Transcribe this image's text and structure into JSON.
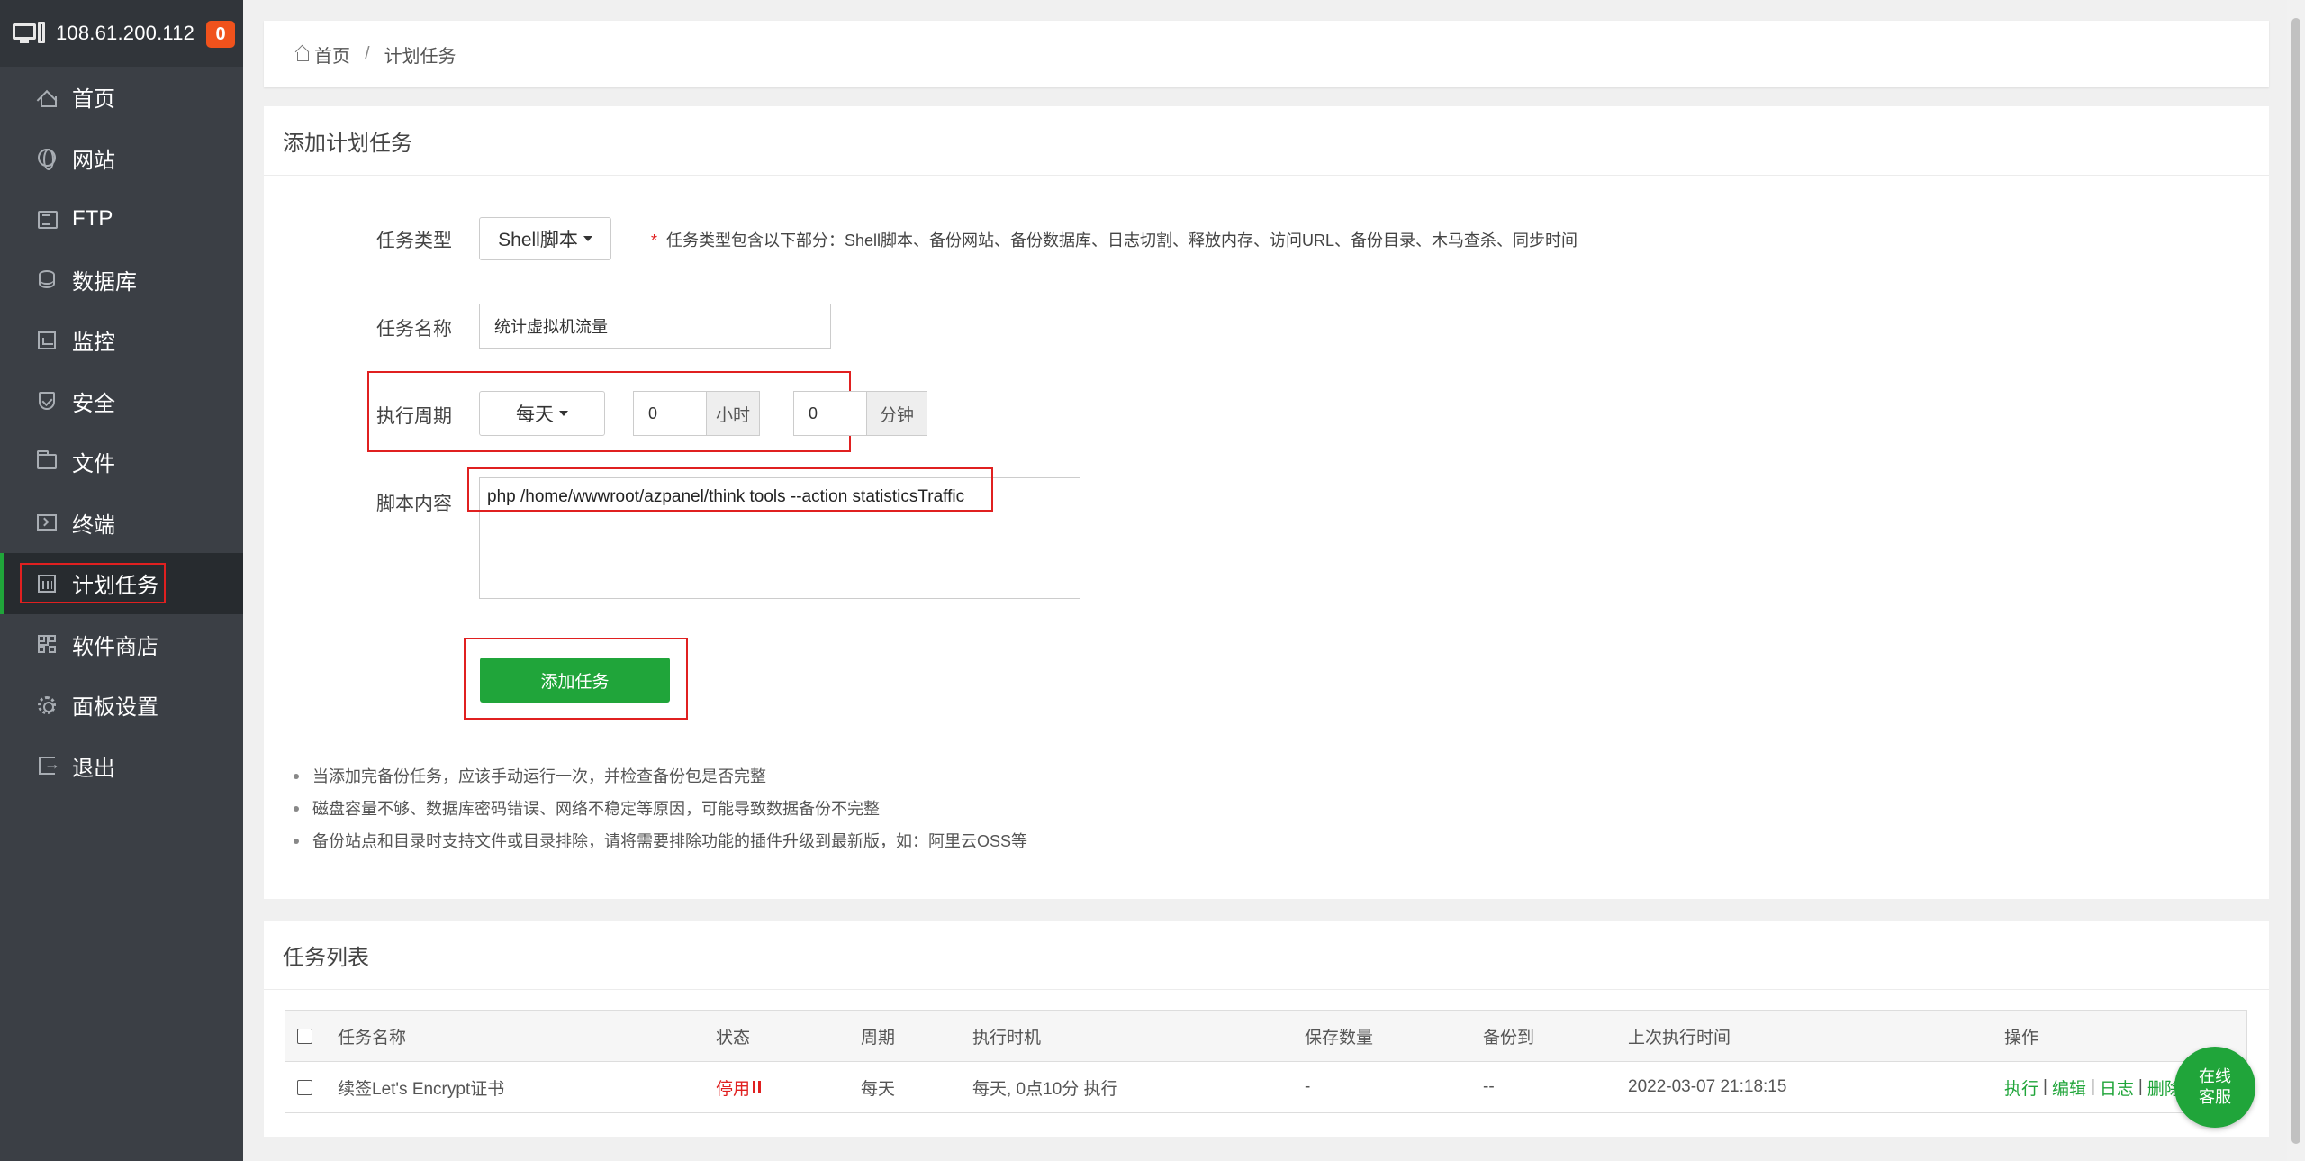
{
  "server": {
    "ip": "108.61.200.112",
    "badge": "0"
  },
  "sidebar": {
    "items": [
      {
        "label": "首页",
        "icon": "home-icon"
      },
      {
        "label": "网站",
        "icon": "globe-icon"
      },
      {
        "label": "FTP",
        "icon": "ftp-icon"
      },
      {
        "label": "数据库",
        "icon": "database-icon"
      },
      {
        "label": "监控",
        "icon": "monitor-icon"
      },
      {
        "label": "安全",
        "icon": "shield-icon"
      },
      {
        "label": "文件",
        "icon": "folder-icon"
      },
      {
        "label": "终端",
        "icon": "terminal-icon"
      },
      {
        "label": "计划任务",
        "icon": "calendar-icon",
        "active": true
      },
      {
        "label": "软件商店",
        "icon": "grid-icon"
      },
      {
        "label": "面板设置",
        "icon": "gear-icon"
      },
      {
        "label": "退出",
        "icon": "exit-icon"
      }
    ]
  },
  "breadcrumb": {
    "home": "首页",
    "separator": "/",
    "current": "计划任务"
  },
  "add_task": {
    "title": "添加计划任务",
    "type_label": "任务类型",
    "type_value": "Shell脚本",
    "type_hint_star": "*",
    "type_hint": "任务类型包含以下部分：Shell脚本、备份网站、备份数据库、日志切割、释放内存、访问URL、备份目录、木马查杀、同步时间",
    "name_label": "任务名称",
    "name_value": "统计虚拟机流量",
    "period_label": "执行周期",
    "period_value": "每天",
    "hour_value": "0",
    "hour_unit": "小时",
    "minute_value": "0",
    "minute_unit": "分钟",
    "script_label": "脚本内容",
    "script_value": "php /home/wwwroot/azpanel/think tools --action statisticsTraffic",
    "submit_label": "添加任务",
    "tips": [
      "当添加完备份任务，应该手动运行一次，并检查备份包是否完整",
      "磁盘容量不够、数据库密码错误、网络不稳定等原因，可能导致数据备份不完整",
      "备份站点和目录时支持文件或目录排除，请将需要排除功能的插件升级到最新版，如：阿里云OSS等"
    ]
  },
  "task_list": {
    "title": "任务列表",
    "columns": [
      "任务名称",
      "状态",
      "周期",
      "执行时机",
      "保存数量",
      "备份到",
      "上次执行时间",
      "操作"
    ],
    "rows": [
      {
        "name": "续签Let's Encrypt证书",
        "status": "停用",
        "period": "每天",
        "timing": "每天, 0点10分 执行",
        "keep": "-",
        "backup_to": "--",
        "last_run": "2022-03-07 21:18:15",
        "ops": [
          "执行",
          "编辑",
          "日志",
          "删除"
        ]
      }
    ]
  },
  "service": {
    "line1": "在线",
    "line2": "客服"
  },
  "colors": {
    "accent": "#20a53a",
    "sidebar": "#3b3f45",
    "highlight": "#e02020",
    "badge": "#f0521c"
  }
}
